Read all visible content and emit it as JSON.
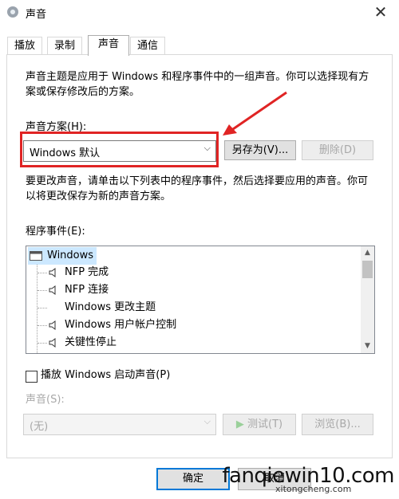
{
  "window": {
    "title": "声音"
  },
  "tabs": [
    {
      "label": "播放"
    },
    {
      "label": "录制"
    },
    {
      "label": "声音"
    },
    {
      "label": "通信"
    }
  ],
  "description": {
    "line1": "声音主题是应用于 Windows 和程序事件中的一组声音。你可以选择现有方",
    "line2": "案或保存修改后的方案。"
  },
  "scheme": {
    "label": "声音方案(H):",
    "selected": "Windows 默认",
    "save_as": "另存为(V)...",
    "delete": "删除(D)"
  },
  "instructions": {
    "line1": "要更改声音，请单击以下列表中的程序事件，然后选择要应用的声音。你可",
    "line2": "以将更改保存为新的声音方案。"
  },
  "events": {
    "label": "程序事件(E):",
    "items": [
      {
        "label": "Windows"
      },
      {
        "label": "NFP 完成"
      },
      {
        "label": "NFP 连接"
      },
      {
        "label": "Windows 更改主题"
      },
      {
        "label": "Windows 用户帐户控制"
      },
      {
        "label": "关键性停止"
      }
    ]
  },
  "startup": {
    "label": "播放 Windows 启动声音(P)"
  },
  "sound": {
    "label": "声音(S):",
    "selected": "(无)",
    "test": "测试(T)",
    "browse": "浏览(B)..."
  },
  "footer": {
    "ok": "确定",
    "cancel": "取消"
  },
  "watermark": {
    "text": "fanqiewin10.com",
    "sub": "xitongcheng.com"
  },
  "colors": {
    "highlight": "#e02424",
    "selection": "#cce8ff"
  }
}
